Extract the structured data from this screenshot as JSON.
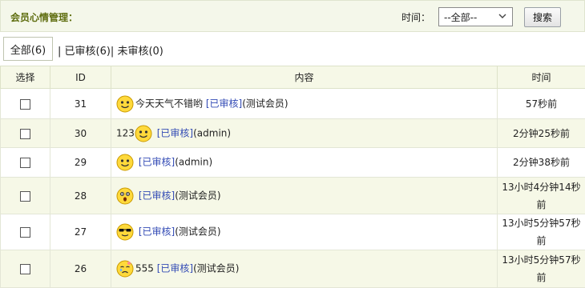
{
  "header": {
    "title": "会员心情管理：",
    "time_label": "时间：",
    "time_select_value": "--全部--",
    "search_button": "搜索"
  },
  "filters": {
    "all": "全部(6)",
    "rest": "| 已审核(6)| 未审核(0)"
  },
  "table": {
    "columns": [
      "选择",
      "ID",
      "内容",
      "时间"
    ],
    "rows": [
      {
        "id": "31",
        "prefix": "",
        "suffix": "今天天气不错哟",
        "status": "[已审核]",
        "user": "(测试会员)",
        "time": "57秒前",
        "icon": "smile-face-icon"
      },
      {
        "id": "30",
        "prefix": "123",
        "suffix": "",
        "status": "[已审核]",
        "user": "(admin)",
        "time": "2分钟25秒前",
        "icon": "smile-face-icon"
      },
      {
        "id": "29",
        "prefix": "",
        "suffix": "",
        "status": "[已审核]",
        "user": "(admin)",
        "time": "2分钟38秒前",
        "icon": "smile-face-icon"
      },
      {
        "id": "28",
        "prefix": "",
        "suffix": "",
        "status": "[已审核]",
        "user": "(测试会员)",
        "time": "13小时4分钟14秒前",
        "icon": "surprised-face-icon"
      },
      {
        "id": "27",
        "prefix": "",
        "suffix": "",
        "status": "[已审核]",
        "user": "(测试会员)",
        "time": "13小时5分钟57秒前",
        "icon": "sunglasses-face-icon"
      },
      {
        "id": "26",
        "prefix": "",
        "suffix": "555",
        "status": "[已审核]",
        "user": "(测试会员)",
        "time": "13小时5分钟57秒前",
        "icon": "crying-face-icon"
      }
    ]
  },
  "colors": {
    "header_bg": "#f4f7ea",
    "title": "#5f6e10",
    "status_link": "#334bb5",
    "alt_row_bg": "#f6f8e7"
  }
}
